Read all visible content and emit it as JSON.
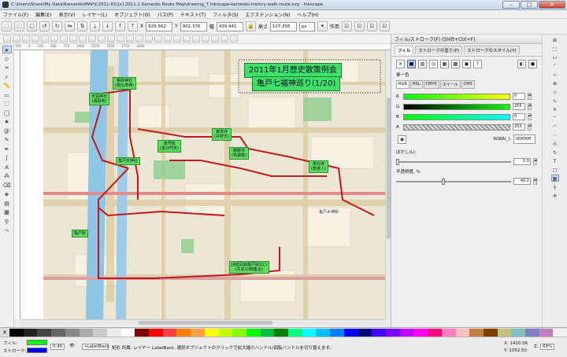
{
  "window": {
    "title": "C:\\Users\\Share\\My Data\\Kameido\\MAP\\C2011-01\\[x] 2011.1 Kameido Route Map\\drawing_7 Inkscape-kameido-history-walk-route.svg - Inkscape",
    "min": "–",
    "max": "□",
    "close": "✕"
  },
  "menu": [
    "ファイル(F)",
    "編集(E)",
    "表示(V)",
    "レイヤー(L)",
    "オブジェクト(O)",
    "パス(P)",
    "テキスト(T)",
    "フィルタ(S)",
    "エクステンション(N)",
    "ヘルプ(H)"
  ],
  "toolctl": {
    "x_label": "X",
    "x": "829.562",
    "y_label": "Y",
    "y": "902.376",
    "w_label": "幅",
    "w": "439.441",
    "h_label": "高さ",
    "h": "107.395",
    "unit": "px",
    "affect": "作用"
  },
  "ruler": "-500 · · · 0 · · · 250 · · · 500 · · · 750 · · · 1000 · · · 1250 · · · 1500 · · · 1750 · · · 2000",
  "map": {
    "title_line1": "2011年1月歴史散策例会",
    "title_line2": "亀戸七福神巡り(1/20)",
    "labels": [
      {
        "name": "label-katori",
        "text": "香取神社\n(恵比寿神)"
      },
      {
        "name": "label-tenjin",
        "text": "天祖神社\n(福禄寿)"
      },
      {
        "name": "label-higashi",
        "text": "東覚寺\n(弁財天)"
      },
      {
        "name": "label-tokoji",
        "text": "龍眼寺\n(布袋尊)"
      },
      {
        "name": "label-hitachi",
        "text": "常光寺\n(寿老人)"
      },
      {
        "name": "label-ryugan",
        "text": "亀戸天神社"
      },
      {
        "name": "label-jizo",
        "text": "普門院\n(毘沙門天)"
      },
      {
        "name": "label-kameido",
        "text": "亀戸駅"
      },
      {
        "name": "label-start",
        "text": "JR総武線亀戸駅北口\n(午前10時集合)"
      }
    ],
    "station_label": "亀戸水神駅"
  },
  "fill_stroke": {
    "dock_title": "フィル/ストローク(F) (Shift+Ctrl+F)",
    "tabs": [
      "フィル",
      "ストロークの塗り(P)",
      "ストロークのスタイル(Y)"
    ],
    "flat_label": "単一色",
    "modes": [
      "RGB",
      "HSL",
      "CMYK",
      "ホイール",
      "CMS"
    ],
    "channels": [
      {
        "name": "R",
        "value": "0"
      },
      {
        "name": "G",
        "value": "255"
      },
      {
        "name": "B",
        "value": "0"
      },
      {
        "name": "A",
        "value": "255"
      }
    ],
    "rgba_label": "RGBA(_):",
    "rgba": "00ff00ff",
    "blur_label": "ぼかし(L):",
    "blur": "0.0",
    "opacity_label": "不透明度, %",
    "opacity": "40.2"
  },
  "status": {
    "fill_label": "フィル:",
    "stroke_label": "ストローク:",
    "opacity": "0.40",
    "layer": "•LabelBack",
    "message": "矩形 所属: レイヤー LabelBack. 選択オブジェクトのクリックで拡大縮小ハンドル/回転ハンドルを切り替えます。",
    "x": "X: 1420.06",
    "y": "Y: 1052.50",
    "z_label": "Z:",
    "zoom": "69%"
  },
  "colors": {
    "accent": "#00ff00",
    "route": "#c0191f"
  }
}
